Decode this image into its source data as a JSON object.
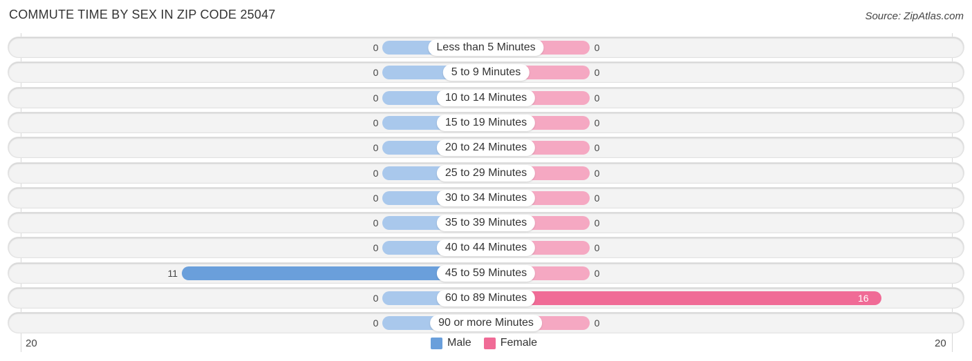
{
  "title": "COMMUTE TIME BY SEX IN ZIP CODE 25047",
  "source": "Source: ZipAtlas.com",
  "colors": {
    "male": "#6a9fdb",
    "male_light": "#a9c8ec",
    "female": "#f06b96",
    "female_light": "#f5a8c2"
  },
  "chart_data": {
    "type": "bar",
    "orientation": "horizontal-diverging",
    "title": "COMMUTE TIME BY SEX IN ZIP CODE 25047",
    "categories": [
      "Less than 5 Minutes",
      "5 to 9 Minutes",
      "10 to 14 Minutes",
      "15 to 19 Minutes",
      "20 to 24 Minutes",
      "25 to 29 Minutes",
      "30 to 34 Minutes",
      "35 to 39 Minutes",
      "40 to 44 Minutes",
      "45 to 59 Minutes",
      "60 to 89 Minutes",
      "90 or more Minutes"
    ],
    "series": [
      {
        "name": "Male",
        "values": [
          0,
          0,
          0,
          0,
          0,
          0,
          0,
          0,
          0,
          11,
          0,
          0
        ]
      },
      {
        "name": "Female",
        "values": [
          0,
          0,
          0,
          0,
          0,
          0,
          0,
          0,
          0,
          0,
          16,
          0
        ]
      }
    ],
    "axis": {
      "left_label": "20",
      "right_label": "20",
      "range": [
        -20,
        20
      ]
    },
    "legend": {
      "position": "bottom-center",
      "entries": [
        "Male",
        "Female"
      ]
    },
    "grid": false
  }
}
